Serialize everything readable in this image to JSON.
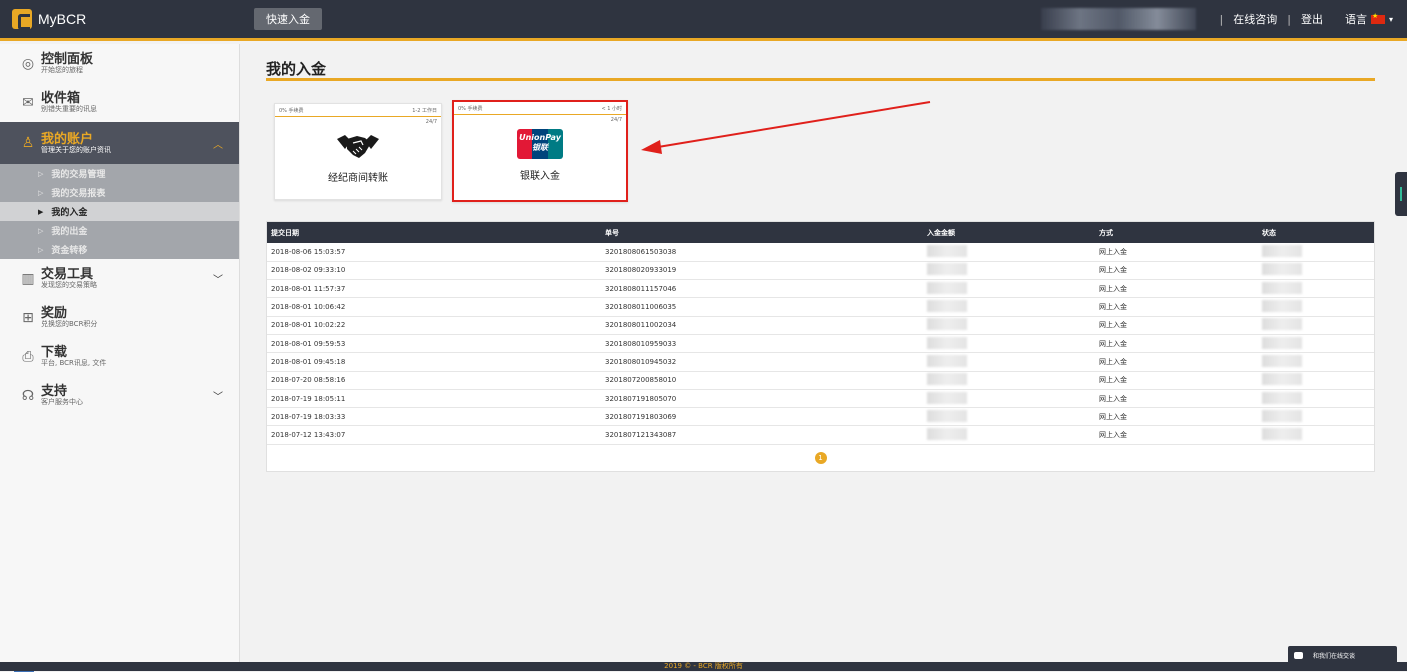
{
  "header": {
    "logo_text": "MyBCR",
    "quick_deposit": "快速入金",
    "online_consult": "在线咨询",
    "logout": "登出",
    "language": "语言",
    "separator": "|"
  },
  "sidebar": {
    "items": [
      {
        "title": "控制面板",
        "sub": "开始您的旅程"
      },
      {
        "title": "收件箱",
        "sub": "别错失重要的讯息"
      },
      {
        "title": "我的账户",
        "sub": "管理关于您的账户资讯"
      },
      {
        "title": "交易工具",
        "sub": "发现您的交易策略"
      },
      {
        "title": "奖励",
        "sub": "兑换您的BCR积分"
      },
      {
        "title": "下载",
        "sub": "平台, BCR讯息, 文件"
      },
      {
        "title": "支持",
        "sub": "客户服务中心"
      }
    ],
    "submenu": [
      "我的交易管理",
      "我的交易报表",
      "我的入金",
      "我的出金",
      "资金转移"
    ]
  },
  "main": {
    "page_title": "我的入金",
    "cards": [
      {
        "fee": "0% 手续费",
        "time": "1-2 工作日",
        "availability": "24/7",
        "label": "经纪商间转账"
      },
      {
        "fee": "0% 手续费",
        "time": "< 1 小时",
        "availability": "24/7",
        "label": "银联入金",
        "logo_line1": "UnionPay",
        "logo_line2": "银联"
      }
    ],
    "table": {
      "headers": [
        "提交日期",
        "单号",
        "入金金额",
        "方式",
        "状态"
      ],
      "rows": [
        [
          "2018-08-06 15:03:57",
          "3201808061503038",
          "",
          "网上入金",
          ""
        ],
        [
          "2018-08-02 09:33:10",
          "3201808020933019",
          "",
          "网上入金",
          ""
        ],
        [
          "2018-08-01 11:57:37",
          "3201808011157046",
          "",
          "网上入金",
          ""
        ],
        [
          "2018-08-01 10:06:42",
          "3201808011006035",
          "",
          "网上入金",
          ""
        ],
        [
          "2018-08-01 10:02:22",
          "3201808011002034",
          "",
          "网上入金",
          ""
        ],
        [
          "2018-08-01 09:59:53",
          "3201808010959033",
          "",
          "网上入金",
          ""
        ],
        [
          "2018-08-01 09:45:18",
          "3201808010945032",
          "",
          "网上入金",
          ""
        ],
        [
          "2018-07-20 08:58:16",
          "3201807200858010",
          "",
          "网上入金",
          ""
        ],
        [
          "2018-07-19 18:05:11",
          "3201807191805070",
          "",
          "网上入金",
          ""
        ],
        [
          "2018-07-19 18:03:33",
          "3201807191803069",
          "",
          "网上入金",
          ""
        ],
        [
          "2018-07-12 13:43:07",
          "3201807121343087",
          "",
          "网上入金",
          ""
        ]
      ]
    },
    "pagination": {
      "current": "1"
    }
  },
  "footer": {
    "text": "2019 © - BCR 版权所有"
  },
  "chat": {
    "label": "和我们在线交谈"
  },
  "colors": {
    "accent": "#e9a825",
    "dark": "#2f3440",
    "highlight": "#e0201b"
  }
}
